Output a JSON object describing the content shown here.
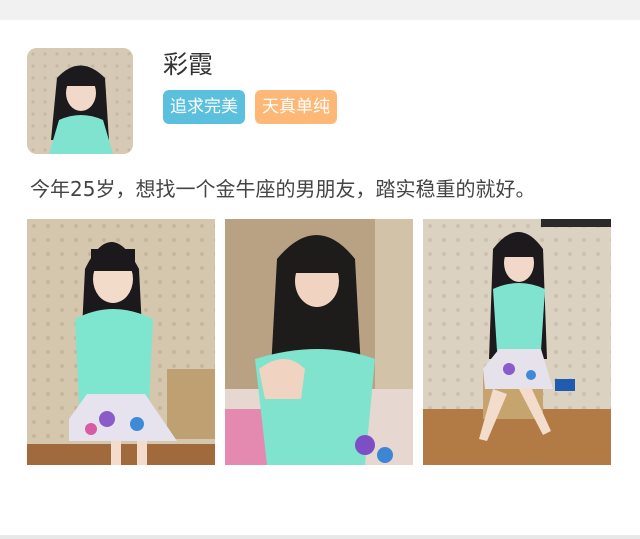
{
  "profile": {
    "name": "彩霞",
    "tags": [
      {
        "label": "追求完美",
        "color": "#5bc0de"
      },
      {
        "label": "天真单纯",
        "color": "#fdb877"
      }
    ],
    "bio": "今年25岁，想找一个金牛座的男朋友，踏实稳重的就好。"
  },
  "photos": [
    {
      "alt": "photo-1"
    },
    {
      "alt": "photo-2"
    },
    {
      "alt": "photo-3"
    }
  ]
}
